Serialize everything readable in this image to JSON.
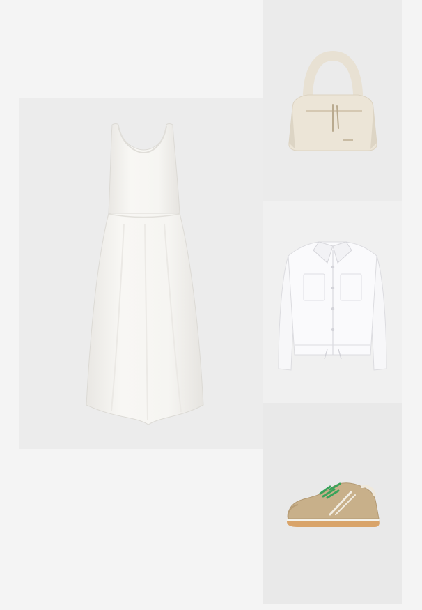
{
  "products": [
    {
      "name": "white-sleeveless-maxi-dress",
      "icon": "dress-icon"
    },
    {
      "name": "cream-hobo-shoulder-bag",
      "icon": "bag-icon"
    },
    {
      "name": "white-denim-jacket",
      "icon": "jacket-icon"
    },
    {
      "name": "beige-suede-sneaker",
      "icon": "sneaker-icon"
    }
  ],
  "colors": {
    "page_background": "#f4f4f4",
    "dress": "#f7f6f3",
    "bag": "#ebe4d6",
    "jacket": "#f8f8fa",
    "sneaker_suede": "#c8b08a",
    "sneaker_laces": "#3aa35a",
    "sneaker_sole": "#d9a46a"
  }
}
